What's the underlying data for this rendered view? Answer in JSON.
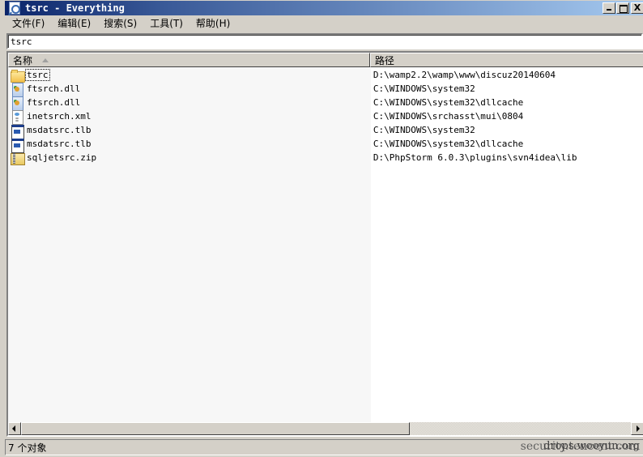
{
  "window": {
    "title": "tsrc - Everything",
    "app_icon": "everything-app-icon",
    "controls": {
      "minimize": "minimize",
      "maximize": "maximize",
      "close": "X"
    }
  },
  "menu": [
    {
      "label": "文件(F)"
    },
    {
      "label": "编辑(E)"
    },
    {
      "label": "搜索(S)"
    },
    {
      "label": "工具(T)"
    },
    {
      "label": "帮助(H)"
    }
  ],
  "search": {
    "value": "tsrc",
    "placeholder": ""
  },
  "columns": {
    "name": "名称",
    "path": "路径",
    "sorted_by": "name",
    "sort_direction": "ascending"
  },
  "results": [
    {
      "name": "tsrc",
      "icon": "folder-icon",
      "path": "D:\\wamp2.2\\wamp\\www\\discuz20140604",
      "focused": true
    },
    {
      "name": "ftsrch.dll",
      "icon": "dll-icon",
      "path": "C:\\WINDOWS\\system32",
      "focused": false
    },
    {
      "name": "ftsrch.dll",
      "icon": "dll-icon",
      "path": "C:\\WINDOWS\\system32\\dllcache",
      "focused": false
    },
    {
      "name": "inetsrch.xml",
      "icon": "xml-icon",
      "path": "C:\\WINDOWS\\srchasst\\mui\\0804",
      "focused": false
    },
    {
      "name": "msdatsrc.tlb",
      "icon": "tlb-icon",
      "path": "C:\\WINDOWS\\system32",
      "focused": false
    },
    {
      "name": "msdatsrc.tlb",
      "icon": "tlb-icon",
      "path": "C:\\WINDOWS\\system32\\dllcache",
      "focused": false
    },
    {
      "name": "sqljetsrc.zip",
      "icon": "zip-icon",
      "path": "D:\\PhpStorm 6.0.3\\plugins\\svn4idea\\lib",
      "focused": false
    }
  ],
  "status": {
    "text": "7 个对象"
  },
  "watermark": {
    "line1": "security.tencent.com",
    "line2": "drops.wooyun.org"
  },
  "colors": {
    "titlebar_start": "#0a246a",
    "titlebar_end": "#a6caf0",
    "chrome": "#d4d0c8",
    "sorted_column_bg": "#f7f7f7"
  }
}
